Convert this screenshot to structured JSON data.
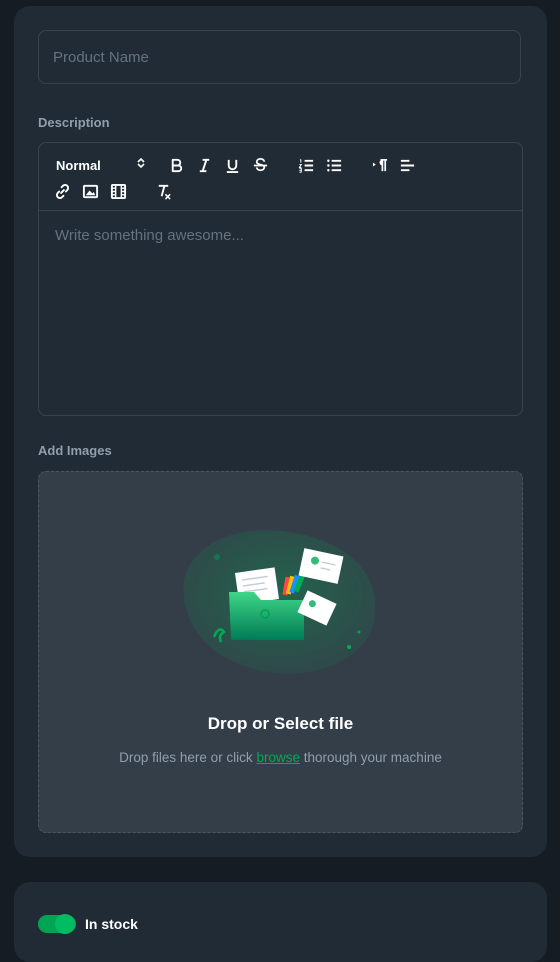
{
  "product_name": {
    "placeholder": "Product Name",
    "value": ""
  },
  "description": {
    "label": "Description",
    "format_select": "Normal",
    "editor_placeholder": "Write something awesome..."
  },
  "images": {
    "label": "Add Images",
    "drop_title": "Drop or Select file",
    "drop_sub_before": "Drop files here or click",
    "drop_link": "browse",
    "drop_sub_after": "thorough your machine"
  },
  "stock": {
    "label": "In stock",
    "enabled": true
  },
  "colors": {
    "background": "#161c24",
    "card": "#212b36",
    "border": "#39434e",
    "dropzone": "#343e48",
    "accent": "#00ab55",
    "muted_text": "#919eab",
    "placeholder_text": "#637381"
  },
  "toolbar_icons": [
    "format-select",
    "bold-icon",
    "italic-icon",
    "underline-icon",
    "strikethrough-icon",
    "ordered-list-icon",
    "bullet-list-icon",
    "text-direction-icon",
    "align-icon",
    "link-icon",
    "image-icon",
    "video-icon",
    "clear-format-icon"
  ]
}
